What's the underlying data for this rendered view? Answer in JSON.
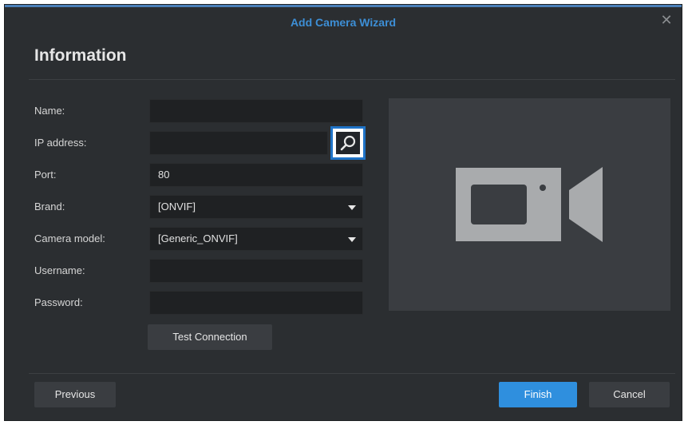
{
  "window": {
    "title": "Add Camera Wizard",
    "close_glyph": "✕"
  },
  "page": {
    "heading": "Information"
  },
  "form": {
    "name": {
      "label": "Name:",
      "value": ""
    },
    "ip_address": {
      "label": "IP address:",
      "value": ""
    },
    "port": {
      "label": "Port:",
      "value": "80"
    },
    "brand": {
      "label": "Brand:",
      "value": "[ONVIF]"
    },
    "camera_model": {
      "label": "Camera model:",
      "value": "[Generic_ONVIF]"
    },
    "username": {
      "label": "Username:",
      "value": ""
    },
    "password": {
      "label": "Password:",
      "value": ""
    }
  },
  "buttons": {
    "test_connection": "Test Connection",
    "previous": "Previous",
    "finish": "Finish",
    "cancel": "Cancel"
  },
  "icons": {
    "search": "search-icon",
    "camera": "video-camera-icon",
    "dropdown": "chevron-down-icon",
    "close": "close-icon"
  },
  "colors": {
    "accent": "#2f8fde",
    "title": "#3d8fd6",
    "highlight_border": "#1f73c7",
    "background": "#2b2e31"
  }
}
